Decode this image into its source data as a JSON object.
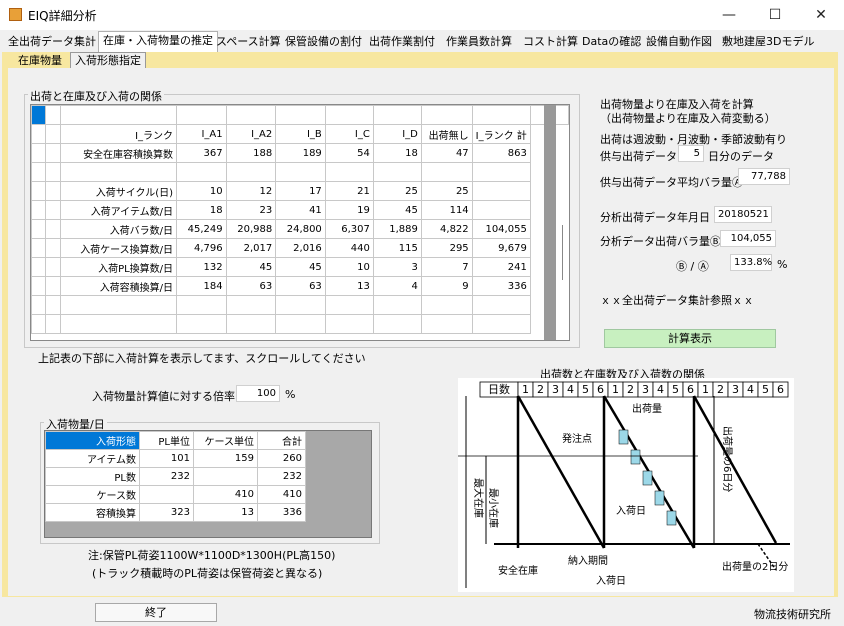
{
  "window": {
    "title": "EIQ詳細分析",
    "minimize": "—",
    "maximize": "☐",
    "close": "✕"
  },
  "tabs": [
    "全出荷データ集計",
    "在庫・入荷物量の推定",
    "スペース計算",
    "保管設備の割付",
    "出荷作業割付",
    "作業員数計算",
    "コスト計算",
    "Dataの確認",
    "設備自動作図",
    "敷地建屋3Dモデル"
  ],
  "subtabs": [
    "在庫物量",
    "入荷形態指定"
  ],
  "group1": {
    "title": "出荷と在庫及び入荷の関係"
  },
  "grid": {
    "header": [
      "I_ランク",
      "I_A1",
      "I_A2",
      "I_B",
      "I_C",
      "I_D",
      "出荷無し",
      "I_ランク 計"
    ],
    "rows": [
      [
        "安全在庫容積換算数",
        "367",
        "188",
        "189",
        "54",
        "18",
        "47",
        "863"
      ],
      [
        "",
        "",
        "",
        "",
        "",
        "",
        "",
        ""
      ],
      [
        "入荷サイクル(日)",
        "10",
        "12",
        "17",
        "21",
        "25",
        "25",
        ""
      ],
      [
        "入荷アイテム数/日",
        "18",
        "23",
        "41",
        "19",
        "45",
        "114",
        ""
      ],
      [
        "入荷バラ数/日",
        "45,249",
        "20,988",
        "24,800",
        "6,307",
        "1,889",
        "4,822",
        "104,055"
      ],
      [
        "入荷ケース換算数/日",
        "4,796",
        "2,017",
        "2,016",
        "440",
        "115",
        "295",
        "9,679"
      ],
      [
        "入荷PL換算数/日",
        "132",
        "45",
        "45",
        "10",
        "3",
        "7",
        "241"
      ],
      [
        "入荷容積換算/日",
        "184",
        "63",
        "63",
        "13",
        "4",
        "9",
        "336"
      ]
    ]
  },
  "scroll_note": "上記表の下部に入荷計算を表示してます、スクロールしてください",
  "right": {
    "heading1": "出荷物量より在庫及入荷を計算",
    "heading2": "（出荷物量より在庫及入荷変動る）",
    "note1": "出荷は週波動・月波動・季節波動有り",
    "provide_label": "供与出荷データ",
    "provide_days": "5",
    "provide_unit": "日分のデータ",
    "avg_label": "供与出荷データ平均バラ量Ⓐ",
    "avg_value": "77,788",
    "date_label": "分析出荷データ年月日",
    "date_value": "20180521",
    "qty_label": "分析データ出荷バラ量Ⓑ",
    "qty_value": "104,055",
    "ratio_label": "Ⓑ / Ⓐ",
    "ratio_value": "133.8%",
    "ratio_unit": "%",
    "ref_note": "ｘｘ全出荷データ集計参照ｘｘ",
    "calc_button": "計算表示"
  },
  "multiplier": {
    "label": "入荷物量計算値に対する倍率",
    "value": "100",
    "unit": "%"
  },
  "group2": {
    "title": "入荷物量/日"
  },
  "small_grid": {
    "header": [
      "入荷形態",
      "PL単位",
      "ケース単位",
      "合計"
    ],
    "rows": [
      [
        "アイテム数",
        "101",
        "159",
        "260"
      ],
      [
        "PL数",
        "232",
        "",
        "232"
      ],
      [
        "ケース数",
        "",
        "410",
        "410"
      ],
      [
        "容積換算",
        "323",
        "13",
        "336"
      ]
    ]
  },
  "footnote1": "注:保管PL荷姿1100W*1100D*1300H(PL高150)",
  "footnote2": "(トラック積載時のPL荷姿は保管荷姿と異なる)",
  "diagram": {
    "title": "出荷数と在庫数及び入荷数の関係",
    "day_label": "日数",
    "days": [
      "1",
      "2",
      "3",
      "4",
      "5",
      "6",
      "1",
      "2",
      "3",
      "4",
      "5",
      "6",
      "1",
      "2",
      "3",
      "4",
      "5",
      "6"
    ],
    "max_stock": "最大在庫",
    "min_stock": "最小在庫",
    "order_point": "発注点",
    "ship_qty": "出荷量",
    "ship_6days": "出荷量の6日分",
    "arrival_day": "入荷日",
    "safety_stock": "安全在庫",
    "lead_time": "納入期間",
    "arrival_day2": "入荷日",
    "ship_2days": "出荷量の2日分"
  },
  "exit_button": "終了",
  "brand": "物流技術研究所",
  "colors": {
    "tab_yellow": "#f7e7a0",
    "calc_button": "#c8f0c0",
    "grid_select": "#0078d7"
  }
}
